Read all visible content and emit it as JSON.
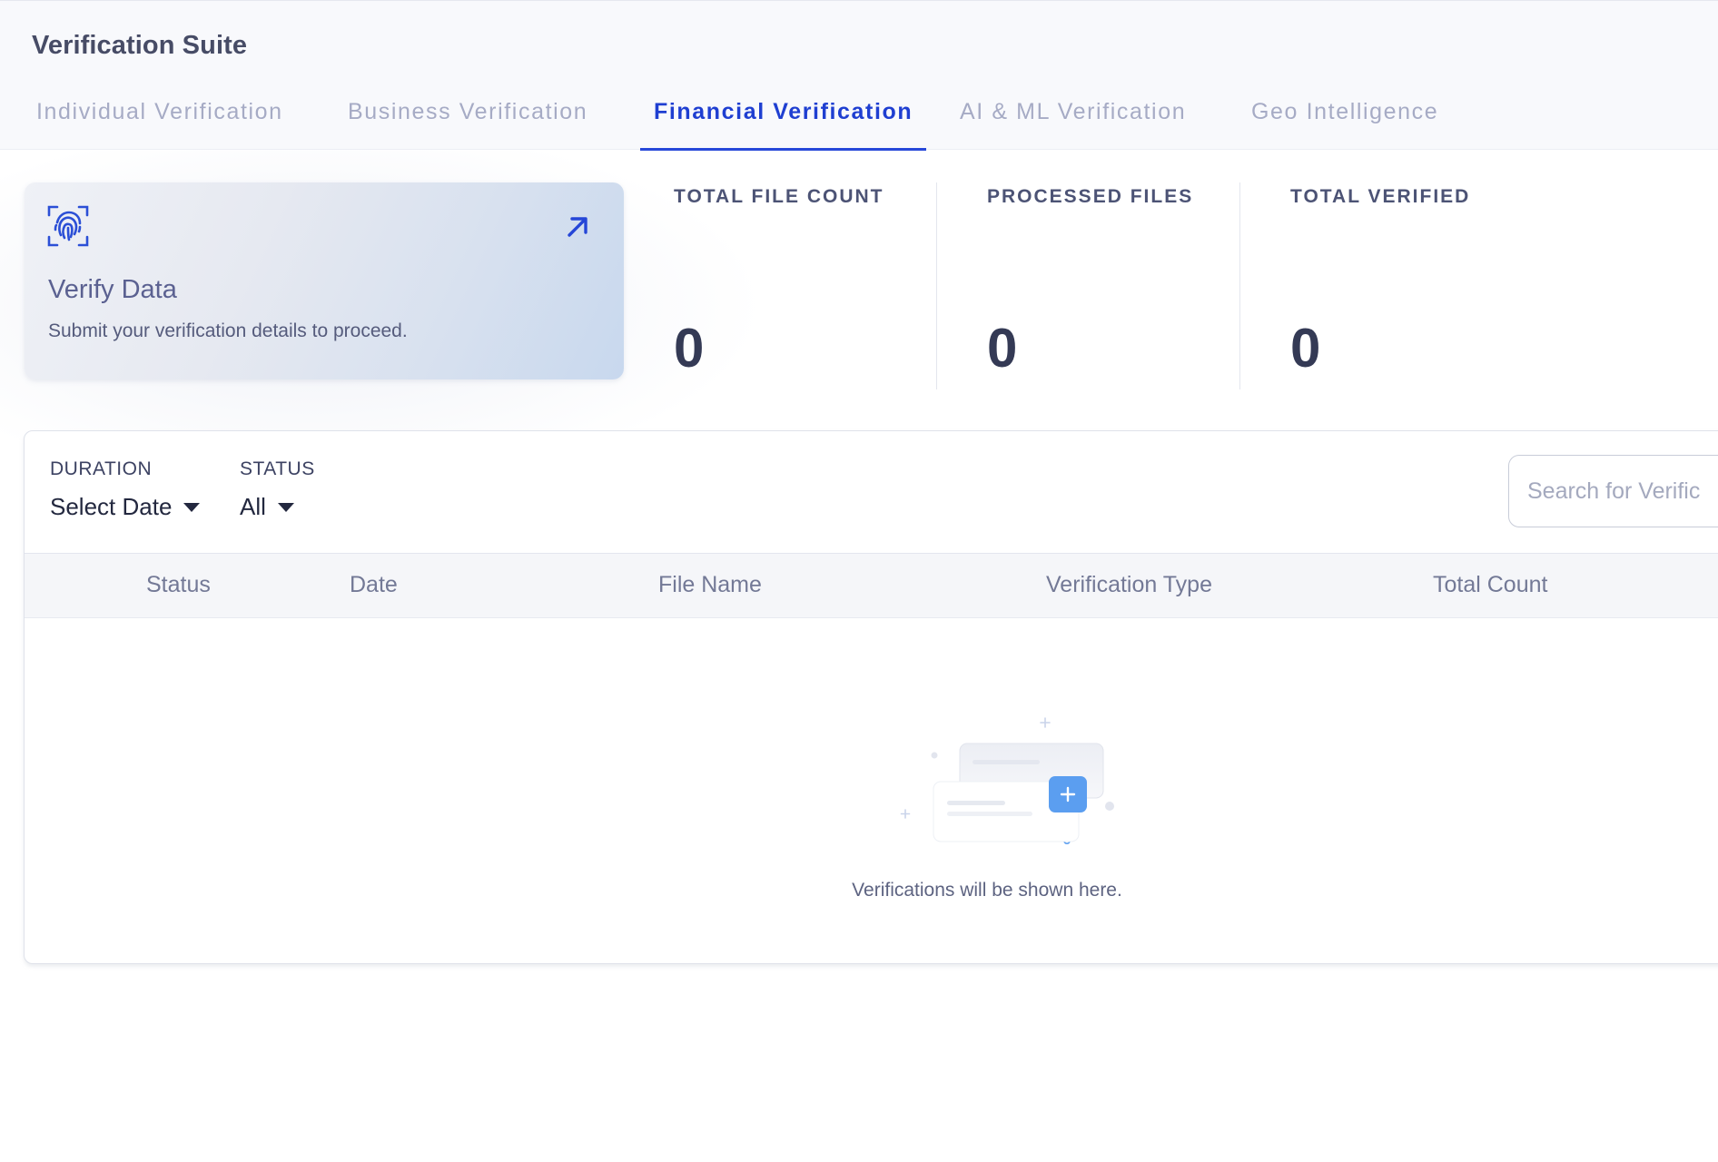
{
  "app": {
    "title": "Verification Suite"
  },
  "tabs": [
    {
      "label": "Individual Verification",
      "active": false
    },
    {
      "label": "Business Verification",
      "active": false
    },
    {
      "label": "Financial Verification",
      "active": true
    },
    {
      "label": "AI & ML Verification",
      "active": false
    },
    {
      "label": "Geo Intelligence",
      "active": false
    }
  ],
  "verify_card": {
    "title": "Verify Data",
    "subtitle": "Submit your verification details to proceed.",
    "icon": "fingerprint-icon",
    "action_icon": "arrow-up-right-icon"
  },
  "stats": [
    {
      "label": "TOTAL FILE COUNT",
      "value": "0"
    },
    {
      "label": "PROCESSED FILES",
      "value": "0"
    },
    {
      "label": "TOTAL VERIFIED",
      "value": "0"
    }
  ],
  "filters": {
    "duration": {
      "label": "DURATION",
      "value": "Select Date"
    },
    "status": {
      "label": "STATUS",
      "value": "All"
    }
  },
  "search": {
    "placeholder": "Search for Verific"
  },
  "table": {
    "columns": [
      "Status",
      "Date",
      "File Name",
      "Verification Type",
      "Total Count"
    ],
    "empty_message": "Verifications will be shown here.",
    "empty_icon": "add-card-icon"
  },
  "colors": {
    "accent": "#1f3fd1",
    "header_bg": "#f8f9fc",
    "table_header_bg": "#f5f6f9",
    "empty_add_button": "#5b9ef0"
  }
}
